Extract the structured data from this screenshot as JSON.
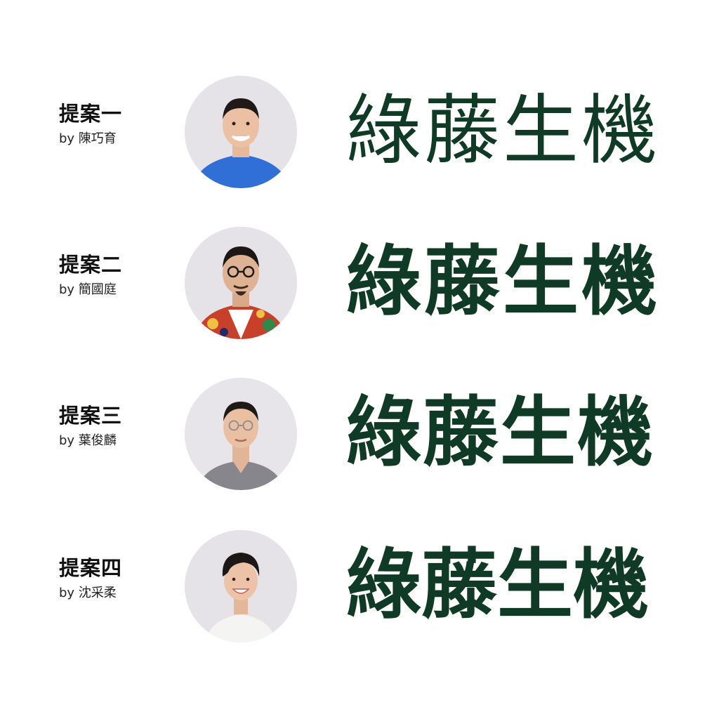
{
  "proposals": [
    {
      "title": "提案一",
      "author": "by 陳巧育",
      "wordmark": "綠藤生機",
      "shirt_color": "#2f6fd6",
      "avatar_icon": "person-portrait-icon"
    },
    {
      "title": "提案二",
      "author": "by 簡國庭",
      "wordmark": "綠藤生機",
      "shirt_color": "#d8452c",
      "avatar_icon": "person-portrait-icon"
    },
    {
      "title": "提案三",
      "author": "by 葉俊麟",
      "wordmark": "綠藤生機",
      "shirt_color": "#86868c",
      "avatar_icon": "person-portrait-icon"
    },
    {
      "title": "提案四",
      "author": "by 沈采柔",
      "wordmark": "綠藤生機",
      "shirt_color": "#f2f2f0",
      "avatar_icon": "person-portrait-icon"
    }
  ],
  "colors": {
    "background": "#ffffff",
    "wordmark": "#0f3a25",
    "avatar_background": "#e4e1e6",
    "text": "#111111"
  }
}
